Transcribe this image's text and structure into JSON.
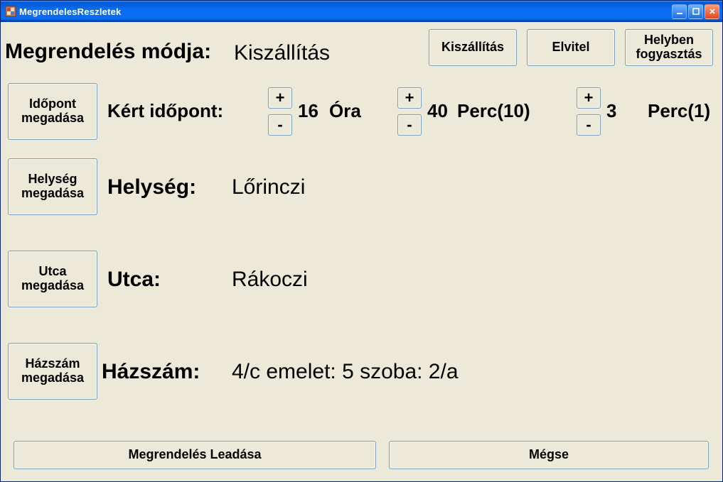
{
  "window": {
    "title": "MegrendelesReszletek"
  },
  "header": {
    "label": "Megrendelés módja:",
    "value": "Kiszállítás",
    "modes": {
      "delivery": "Kiszállítás",
      "takeaway": "Elvitel",
      "dinein": "Helyben fogyasztás"
    }
  },
  "time": {
    "button": "Időpont megadása",
    "label": "Kért időpont:",
    "plus": "+",
    "minus": "-",
    "hour_value": "16",
    "hour_unit": "Óra",
    "min10_value": "40",
    "min10_unit": "Perc(10)",
    "min1_value": "3",
    "min1_unit": "Perc(1)"
  },
  "city": {
    "button": "Helység megadása",
    "label": "Helység:",
    "value": "Lőrinczi"
  },
  "street": {
    "button": "Utca megadása",
    "label": "Utca:",
    "value": "Rákoczi"
  },
  "houseno": {
    "button": "Házszám megadása",
    "label": "Házszám:",
    "value": "4/c emelet: 5 szoba: 2/a"
  },
  "footer": {
    "submit": "Megrendelés Leadása",
    "cancel": "Mégse"
  }
}
